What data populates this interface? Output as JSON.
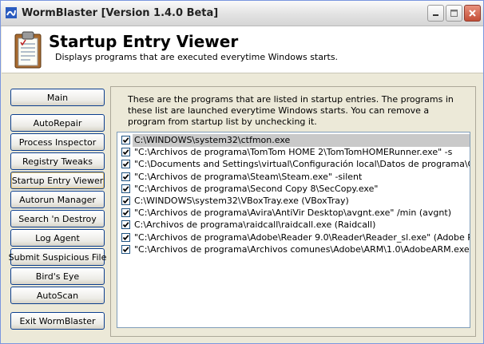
{
  "window": {
    "title": "WormBlaster [Version 1.4.0 Beta]"
  },
  "header": {
    "title": "Startup Entry Viewer",
    "subtitle": "Displays programs that are executed everytime Windows starts."
  },
  "nav": {
    "main": "Main",
    "autorepair": "AutoRepair",
    "process_inspector": "Process Inspector",
    "registry_tweaks": "Registry Tweaks",
    "startup_entry_viewer": "Startup Entry Viewer",
    "autorun_manager": "Autorun Manager",
    "search_destroy": "Search 'n Destroy",
    "log_agent": "Log Agent",
    "submit_suspicious": "Submit Suspicious File",
    "birds_eye": "Bird's Eye",
    "autoscan": "AutoScan",
    "exit": "Exit WormBlaster"
  },
  "content": {
    "description": "These are the programs that are listed in startup entries. The programs in these list are launched everytime Windows starts. You can remove a program from startup list by unchecking it.",
    "entries": [
      {
        "text": "C:\\WINDOWS\\system32\\ctfmon.exe",
        "checked": true,
        "selected": true
      },
      {
        "text": "\"C:\\Archivos de programa\\TomTom HOME 2\\TomTomHOMERunner.exe\" -s",
        "checked": true
      },
      {
        "text": "\"C:\\Documents and Settings\\virtual\\Configuración local\\Datos de programa\\Google\\Update\\GoogleUpdate.exe\"",
        "checked": true
      },
      {
        "text": "\"C:\\Archivos de programa\\Steam\\Steam.exe\" -silent",
        "checked": true
      },
      {
        "text": "\"C:\\Archivos de programa\\Second Copy 8\\SecCopy.exe\"",
        "checked": true
      },
      {
        "text": "C:\\WINDOWS\\system32\\VBoxTray.exe (VBoxTray)",
        "checked": true
      },
      {
        "text": "\"C:\\Archivos de programa\\Avira\\AntiVir Desktop\\avgnt.exe\" /min (avgnt)",
        "checked": true
      },
      {
        "text": "C:\\Archivos de programa\\raidcall\\raidcall.exe (Raidcall)",
        "checked": true
      },
      {
        "text": "\"C:\\Archivos de programa\\Adobe\\Reader 9.0\\Reader\\Reader_sl.exe\" (Adobe Reader Speed Launch)",
        "checked": true
      },
      {
        "text": "\"C:\\Archivos de programa\\Archivos comunes\\Adobe\\ARM\\1.0\\AdobeARM.exe\" (Adobe ARM)",
        "checked": true
      }
    ]
  }
}
